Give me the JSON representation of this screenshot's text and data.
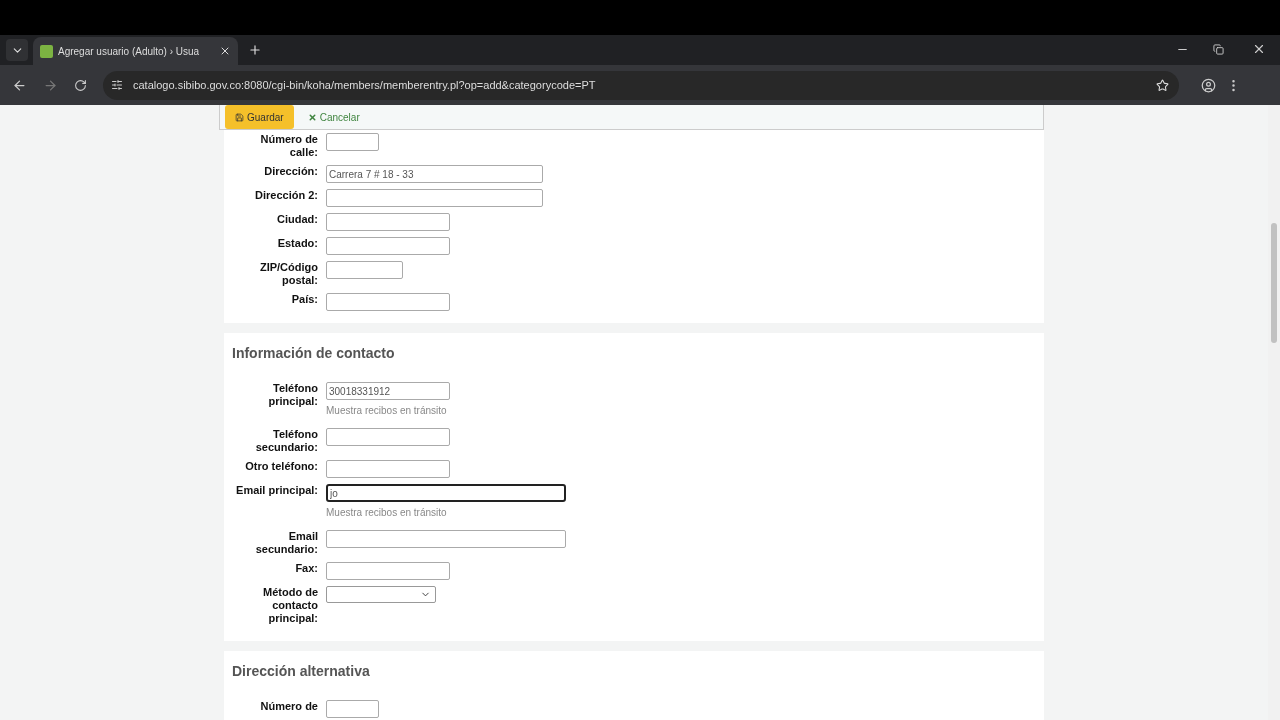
{
  "browser": {
    "tab_title": "Agregar usuario (Adulto) › Usua",
    "url": "catalogo.sibibo.gov.co:8080/cgi-bin/koha/members/memberentry.pl?op=add&categorycode=PT"
  },
  "toolbar": {
    "save": "Guardar",
    "cancel": "Cancelar"
  },
  "sections": [
    {
      "fields": [
        {
          "label": "Número de calle:",
          "kind": "short"
        },
        {
          "label": "Dirección:",
          "kind": "address",
          "value": "Carrera 7 # 18 - 33"
        },
        {
          "label": "Dirección 2:",
          "kind": "address"
        },
        {
          "label": "Ciudad:",
          "kind": "line"
        },
        {
          "label": "Estado:",
          "kind": "line"
        },
        {
          "label": "ZIP/Código postal:",
          "kind": "postal"
        },
        {
          "label": "País:",
          "kind": "line"
        }
      ]
    },
    {
      "title": "Información de contacto",
      "fields": [
        {
          "label": "Teléfono principal:",
          "kind": "line",
          "value": "30018331912",
          "hint": "Muestra recibos en tránsito"
        },
        {
          "label": "Teléfono secundario:",
          "kind": "line"
        },
        {
          "label": "Otro teléfono:",
          "kind": "line"
        },
        {
          "label": "Email principal:",
          "kind": "email",
          "value": "jo",
          "focused": true,
          "hint": "Muestra recibos en tránsito"
        },
        {
          "label": "Email secundario:",
          "kind": "email"
        },
        {
          "label": "Fax:",
          "kind": "line"
        },
        {
          "label": "Método de contacto principal:",
          "kind": "select"
        }
      ]
    },
    {
      "title": "Dirección alternativa",
      "fields": [
        {
          "label": "Número de",
          "kind": "short"
        }
      ]
    }
  ]
}
